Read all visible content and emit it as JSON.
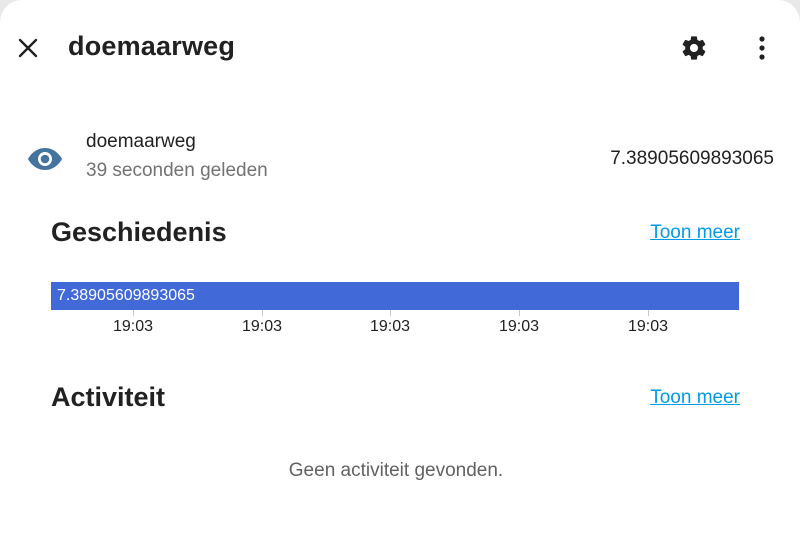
{
  "header": {
    "title": "doemaarweg",
    "close_icon": "close-icon",
    "settings_icon": "gear-icon",
    "more_icon": "more-vertical-icon"
  },
  "entity": {
    "icon": "eye-icon",
    "name": "doemaarweg",
    "last_changed": "39 seconden geleden",
    "state": "7.38905609893065"
  },
  "history": {
    "title": "Geschiedenis",
    "show_more": "Toon meer",
    "bar_label": "7.38905609893065",
    "bar_color": "#4169d8",
    "ticks": [
      "19:03",
      "19:03",
      "19:03",
      "19:03",
      "19:03"
    ]
  },
  "activity": {
    "title": "Activiteit",
    "show_more": "Toon meer",
    "empty_message": "Geen activiteit gevonden."
  },
  "colors": {
    "link": "#039be5",
    "icon": "#44739e"
  }
}
